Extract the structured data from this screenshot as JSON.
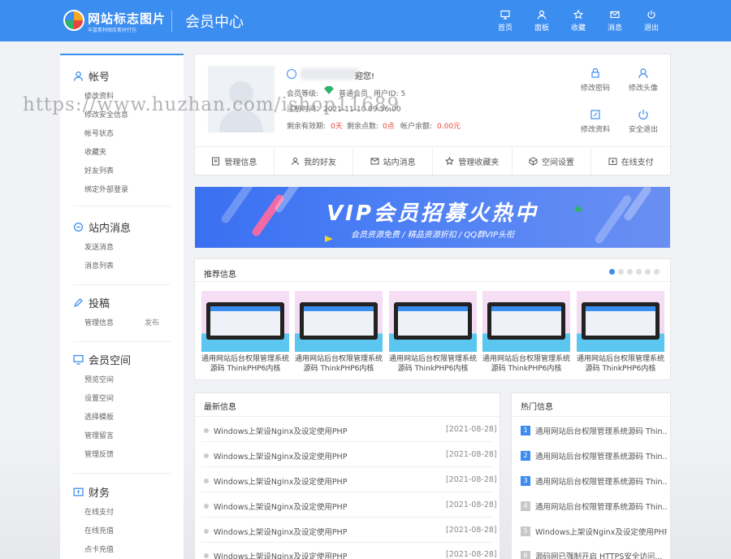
{
  "header": {
    "logo_text": "网站标志图片",
    "logo_sub": "丰富素材图库素材打包",
    "title": "会员中心",
    "nav": [
      {
        "label": "首页",
        "icon": "monitor-icon"
      },
      {
        "label": "面板",
        "icon": "user-icon"
      },
      {
        "label": "收藏",
        "icon": "star-icon"
      },
      {
        "label": "消息",
        "icon": "mail-icon"
      },
      {
        "label": "退出",
        "icon": "power-icon"
      }
    ]
  },
  "sidebar": {
    "account": {
      "title": "帐号",
      "items": [
        "修改资料",
        "修改安全信息",
        "帐号状态",
        "收藏夹",
        "好友列表",
        "绑定外部登录"
      ]
    },
    "messages": {
      "title": "站内消息",
      "items": [
        "发送消息",
        "消息列表"
      ]
    },
    "submit": {
      "title": "投稿",
      "items": [
        "管理信息"
      ],
      "extra": "发布"
    },
    "space": {
      "title": "会员空间",
      "items": [
        "预览空间",
        "设置空间",
        "选择模板",
        "管理留言",
        "管理反馈"
      ]
    },
    "finance": {
      "title": "财务",
      "items": [
        "在线支付",
        "在线充值",
        "点卡充值"
      ]
    }
  },
  "profile": {
    "welcome": "迎您!",
    "level_label": "会员等级:",
    "level": "普通会员",
    "uid": "用户ID: 5",
    "reg": "注册时间：2021-11-10 09:56:00",
    "valid_label": "剩余有效期:",
    "valid_value": "0天",
    "points_label": "剩余点数:",
    "points_value": "0点",
    "balance_label": "帐户余额:",
    "balance_value": "0.00元",
    "actions": [
      "修改密码",
      "修改头像",
      "修改资料",
      "安全退出"
    ]
  },
  "tabs": [
    "管理信息",
    "我的好友",
    "站内消息",
    "管理收藏夹",
    "空间设置",
    "在线支付"
  ],
  "banner": {
    "title": "VIP会员招募火热中",
    "subtitle": "会员资源免费 / 精品资源折扣 / QQ群VIP头衔"
  },
  "recommend": {
    "title": "推荐信息",
    "items": [
      "通用网站后台权限管理系统源码 ThinkPHP6内核",
      "通用网站后台权限管理系统源码 ThinkPHP6内核",
      "通用网站后台权限管理系统源码 ThinkPHP6内核",
      "通用网站后台权限管理系统源码 ThinkPHP6内核",
      "通用网站后台权限管理系统源码 ThinkPHP6内核"
    ]
  },
  "latest": {
    "title": "最新信息",
    "items": [
      {
        "text": "Windows上架设Nginx及设定使用PHP",
        "date": "[2021-08-28]"
      },
      {
        "text": "Windows上架设Nginx及设定使用PHP",
        "date": "[2021-08-28]"
      },
      {
        "text": "Windows上架设Nginx及设定使用PHP",
        "date": "[2021-08-28]"
      },
      {
        "text": "Windows上架设Nginx及设定使用PHP",
        "date": "[2021-08-28]"
      },
      {
        "text": "Windows上架设Nginx及设定使用PHP",
        "date": "[2021-08-28]"
      },
      {
        "text": "Windows上架设Nginx及设定使用PHP",
        "date": "[2021-08-28]"
      }
    ]
  },
  "hot": {
    "title": "热门信息",
    "items": [
      {
        "n": "1",
        "text": "通用网站后台权限管理系统源码 Thin..."
      },
      {
        "n": "2",
        "text": "通用网站后台权限管理系统源码 Thin..."
      },
      {
        "n": "3",
        "text": "通用网站后台权限管理系统源码 Thin..."
      },
      {
        "n": "4",
        "text": "通用网站后台权限管理系统源码 Thin..."
      },
      {
        "n": "5",
        "text": "Windows上架设Nginx及设定使用PHP"
      },
      {
        "n": "6",
        "text": "源码网已强制开启 HTTPS安全访问..."
      }
    ]
  },
  "watermark": "https://www.huzhan.com/ishop11689",
  "colors": {
    "primary": "#3c8df0",
    "accent_red": "#e8453c"
  }
}
